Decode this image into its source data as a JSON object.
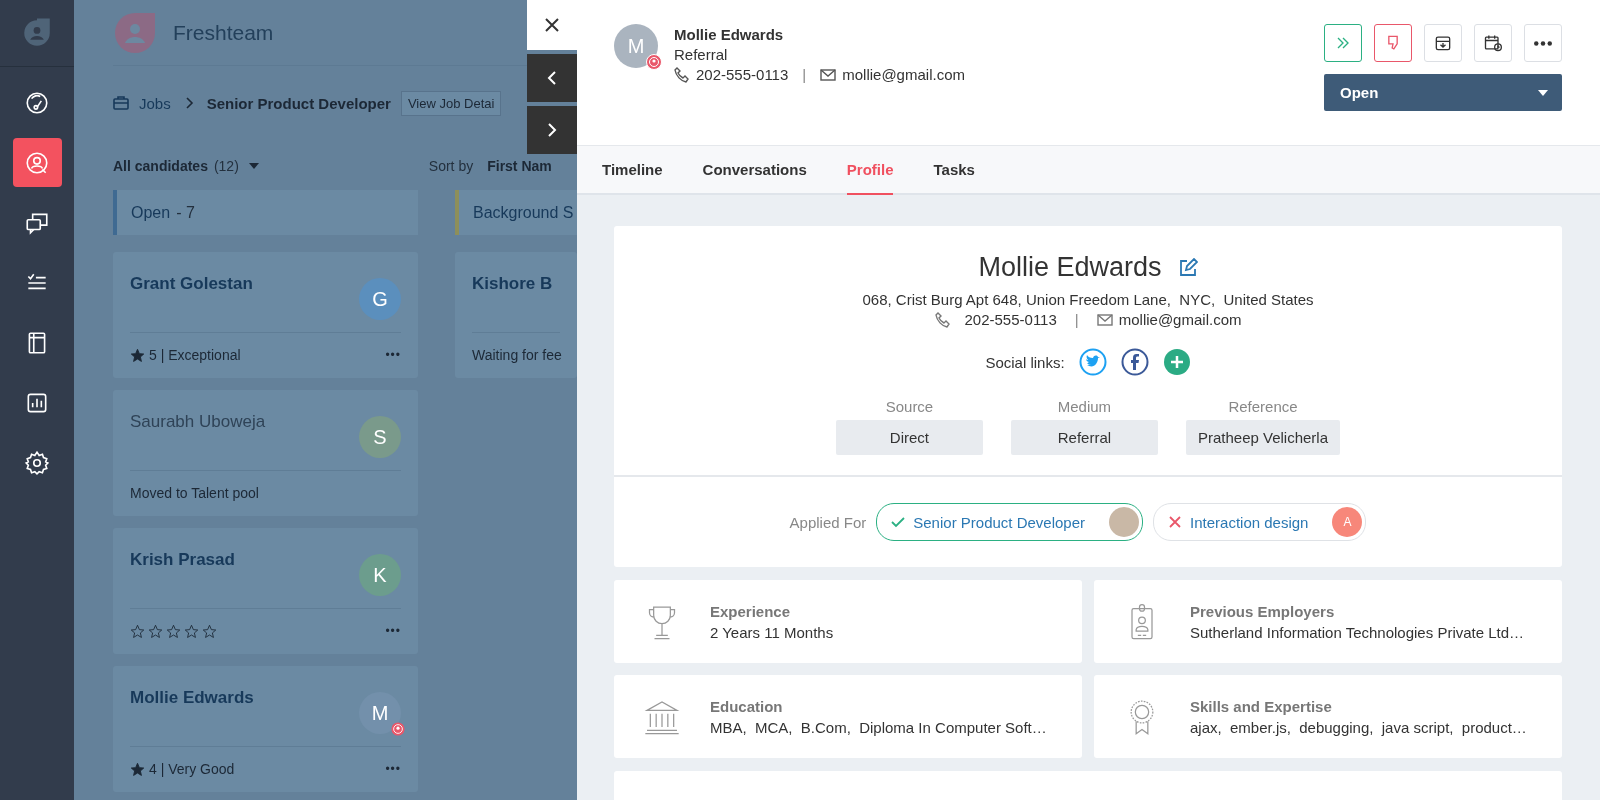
{
  "nav": {
    "items": [
      {
        "kind": "dashboard",
        "selected": false
      },
      {
        "kind": "candidates",
        "selected": true
      },
      {
        "kind": "conversations",
        "selected": false
      },
      {
        "kind": "tasks",
        "selected": false
      },
      {
        "kind": "book",
        "selected": false
      },
      {
        "kind": "reports",
        "selected": false
      },
      {
        "kind": "settings",
        "selected": false
      }
    ]
  },
  "app": {
    "title": "Freshteam"
  },
  "breadcrumb": {
    "root": "Jobs",
    "current": "Senior Product Developer",
    "button": "View Job Detai"
  },
  "filter": {
    "label": "All candidates",
    "count": "(12)",
    "sort_label": "Sort by",
    "sort_value": "First Nam"
  },
  "columns": [
    {
      "title": "Open",
      "count": "- 7",
      "color": "#3f6a92",
      "cards": [
        {
          "name": "Grant Golestan",
          "initial": "G",
          "color": "#5b8fbd",
          "muted": false,
          "badge": false,
          "kind": "rating",
          "text": "5 | Exceptional",
          "menu": "•••"
        },
        {
          "name": "Saurabh Uboweja",
          "initial": "S",
          "color": "#7a9a8b",
          "muted": true,
          "badge": false,
          "kind": "status",
          "text": "Moved to Talent pool"
        },
        {
          "name": "Krish Prasad",
          "initial": "K",
          "color": "#6c9d8d",
          "muted": false,
          "badge": false,
          "kind": "stars",
          "stars": 0,
          "menu": "•••"
        },
        {
          "name": "Mollie Edwards",
          "initial": "M",
          "color": "#7390ab",
          "muted": false,
          "badge": true,
          "kind": "rating",
          "text": "4 | Very Good",
          "menu": "•••"
        }
      ]
    },
    {
      "title": "Background S",
      "color": "#8d8f5a",
      "cards": [
        {
          "name": "Kishore B",
          "muted": false,
          "kind": "status",
          "text": "Waiting for fee"
        }
      ]
    }
  ],
  "panel": {
    "candidate": {
      "initial": "M",
      "name": "Mollie Edwards",
      "source": "Referral",
      "phone": "202-555-0113",
      "separator": "|",
      "email": "mollie@gmail.com"
    },
    "actions": [
      {
        "kind": "advance"
      },
      {
        "kind": "reject"
      },
      {
        "kind": "archive"
      },
      {
        "kind": "schedule"
      },
      {
        "kind": "more"
      }
    ],
    "status": {
      "value": "Open"
    },
    "tabs": [
      {
        "label": "Timeline",
        "selected": false
      },
      {
        "label": "Conversations",
        "selected": false
      },
      {
        "label": "Profile",
        "selected": true
      },
      {
        "label": "Tasks",
        "selected": false
      }
    ],
    "profile": {
      "name": "Mollie Edwards",
      "address": "068, Crist Burg Apt 648, Union Freedom Lane,  NYC,  United States",
      "phone": "202-555-0113",
      "separator": "|",
      "email": "mollie@gmail.com",
      "social_label": "Social links:",
      "social": [
        {
          "kind": "twitter"
        },
        {
          "kind": "facebook"
        },
        {
          "kind": "add"
        }
      ],
      "fields": [
        {
          "label": "Source",
          "value": "Direct"
        },
        {
          "label": "Medium",
          "value": "Referral"
        },
        {
          "label": "Reference",
          "value": "Pratheep Velicherla"
        }
      ],
      "applied_label": "Applied For",
      "applied": [
        {
          "kind": "active",
          "title": "Senior Product Developer"
        },
        {
          "kind": "rejected",
          "title": "Interaction design",
          "initial": "A",
          "color": "#f7877a"
        }
      ]
    },
    "details": [
      {
        "kind": "trophy",
        "label": "Experience",
        "value": "2 Years 11 Months"
      },
      {
        "kind": "id-card",
        "label": "Previous Employers",
        "value": "Sutherland Information Technologies Private Ltd…"
      },
      {
        "kind": "building",
        "label": "Education",
        "value": "MBA,  MCA,  B.Com,  Diploma In Computer Soft…"
      },
      {
        "kind": "ribbon",
        "label": "Skills and Expertise",
        "value": "ajax,  ember.js,  debugging,  java script,  product…"
      }
    ]
  }
}
